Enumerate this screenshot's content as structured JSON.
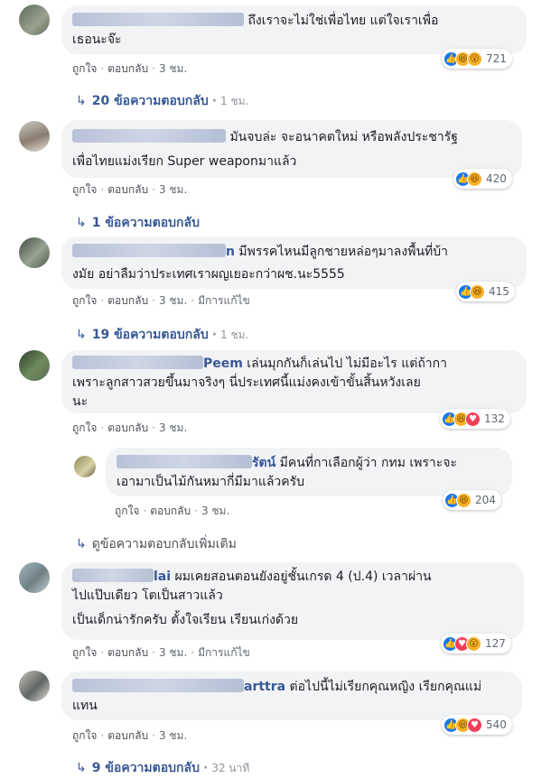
{
  "labels": {
    "like": "ถูกใจ",
    "reply": "ตอบกลับ",
    "edited": "มีการแก้ไข",
    "sep": "·"
  },
  "comments": [
    {
      "name_tail": "",
      "text_lines": [
        "ถึงเราจะไม่ใช่เพื่อไทย แต่ใจเราเพื่อ",
        "เธอนะจ๊ะ"
      ],
      "time": "3 ชม.",
      "reaction_count": "721",
      "reactions": [
        "like-icon",
        "haha-icon",
        "wow-icon"
      ],
      "replies_label": "20 ข้อความตอบกลับ",
      "replies_time": "1 ชม."
    },
    {
      "name_tail": "",
      "text_lines": [
        "มันจบล่ะ จะอนาคตใหม่ หรือพลังประชารัฐ",
        "เพื่อไทยแม่งเรียก Super weaponมาแล้ว"
      ],
      "time": "3 ชม.",
      "reaction_count": "420",
      "reactions": [
        "like-icon",
        "haha-icon"
      ],
      "replies_label": "1 ข้อความตอบกลับ",
      "replies_time": ""
    },
    {
      "name_tail": "n",
      "text_lines": [
        "มีพรรคไหนมีลูกชายหล่อๆมาลงพื้นที่บ้า",
        "งมัย อย่าลืมว่าประเทศเราผญเยอะกว่าผช.นะ5555"
      ],
      "time": "3 ชม.",
      "edited": true,
      "reaction_count": "415",
      "reactions": [
        "like-icon",
        "haha-icon"
      ],
      "replies_label": "19 ข้อความตอบกลับ",
      "replies_time": "1 ชม."
    },
    {
      "name_tail": "Peem",
      "text_lines": [
        "เล่นมุกกันก็เล่นไป ไม่มีอะไร แต่ถ้ากา",
        "เพราะลูกสาวสวยขึ้นมาจริงๆ นี่ประเทศนี้แม่งคงเข้าขั้นสิ้นหวังเลย",
        "นะ"
      ],
      "time": "3 ชม.",
      "reaction_count": "132",
      "reactions": [
        "like-icon",
        "haha-icon",
        "love-icon"
      ]
    },
    {
      "name_tail": "รัตน์",
      "text_lines": [
        "มีคนที่กาเลือกผู้ว่า กทม เพราะจะ",
        "เอามาเป็นไม้กันหมากี่มีมาแล้วครับ"
      ],
      "time": "3 ชม.",
      "reaction_count": "204",
      "reactions": [
        "like-icon",
        "haha-icon"
      ],
      "replies_label": "ดูข้อความตอบกลับเพิ่มเติม",
      "replies_time": ""
    },
    {
      "name_tail": "lai",
      "text_lines": [
        "ผมเคยสอนตอนยังอยู่ชั้นเกรด 4 (ป.4) เวลาผ่าน",
        "ไปแป๊บเดียว โตเป็นสาวแล้ว",
        "",
        "เป็นเด็กน่ารักครับ ตั้งใจเรียน เรียนเก่งด้วย"
      ],
      "time": "3 ชม.",
      "edited": true,
      "reaction_count": "127",
      "reactions": [
        "like-icon",
        "love-icon",
        "wow-icon"
      ]
    },
    {
      "name_tail": "arttra",
      "text_lines": [
        "ต่อไปนี้ไม่เรียกคุณหญิง เรียกคุณแม่",
        "แทน"
      ],
      "time": "3 ชม.",
      "reaction_count": "540",
      "reactions": [
        "like-icon",
        "haha-icon",
        "love-icon"
      ],
      "replies_label": "9 ข้อความตอบกลับ",
      "replies_time": "32 นาที"
    }
  ]
}
